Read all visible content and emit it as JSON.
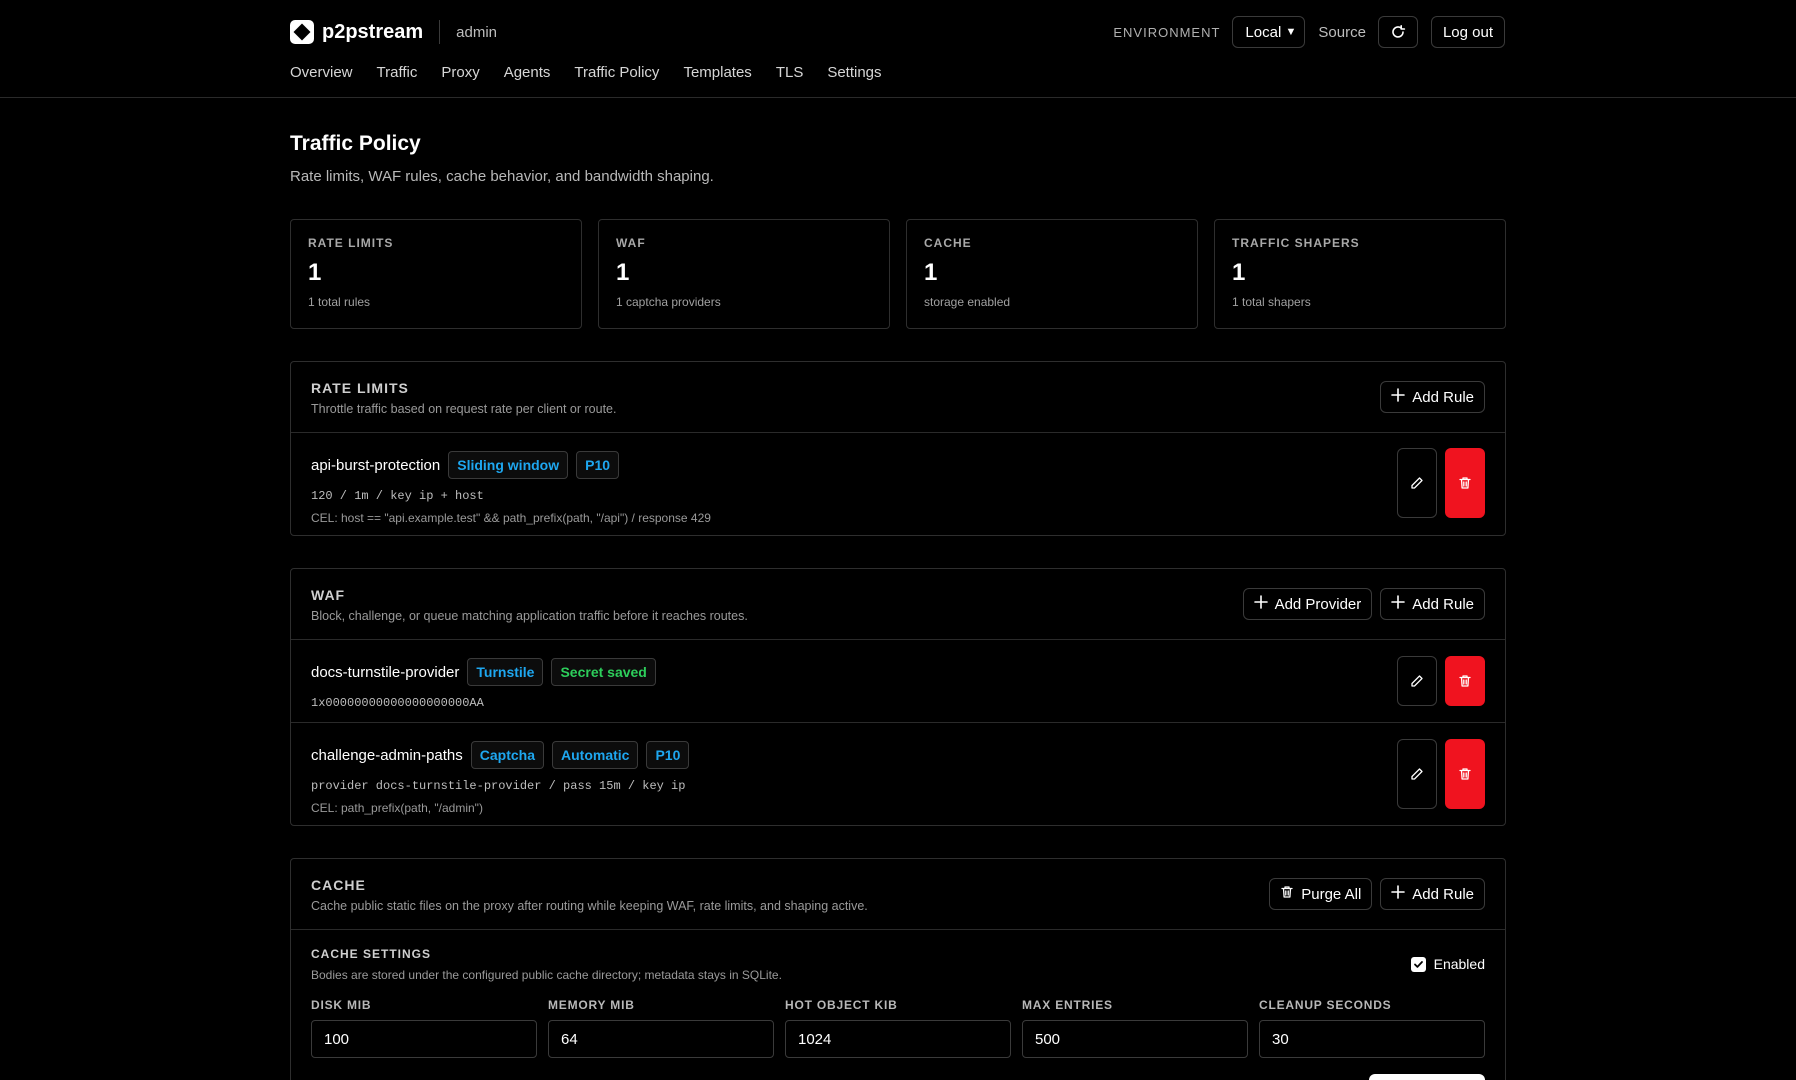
{
  "header": {
    "brand": "p2pstream",
    "user": "admin",
    "env_label": "ENVIRONMENT",
    "env_value": "Local",
    "source": "Source",
    "logout": "Log out"
  },
  "nav": [
    "Overview",
    "Traffic",
    "Proxy",
    "Agents",
    "Traffic Policy",
    "Templates",
    "TLS",
    "Settings"
  ],
  "page": {
    "title": "Traffic Policy",
    "subtitle": "Rate limits, WAF rules, cache behavior, and bandwidth shaping."
  },
  "stats": [
    {
      "label": "RATE LIMITS",
      "value": "1",
      "sub": "1 total rules"
    },
    {
      "label": "WAF",
      "value": "1",
      "sub": "1 captcha providers"
    },
    {
      "label": "CACHE",
      "value": "1",
      "sub": "storage enabled"
    },
    {
      "label": "TRAFFIC SHAPERS",
      "value": "1",
      "sub": "1 total shapers"
    }
  ],
  "rate_limits": {
    "title": "RATE LIMITS",
    "desc": "Throttle traffic based on request rate per client or route.",
    "add_rule": "Add Rule",
    "rules": [
      {
        "name": "api-burst-protection",
        "tags": [
          "Sliding window",
          "P10"
        ],
        "line": "120 / 1m / key ip + host",
        "cel": "CEL: host == \"api.example.test\" && path_prefix(path, \"/api\") / response 429"
      }
    ]
  },
  "waf": {
    "title": "WAF",
    "desc": "Block, challenge, or queue matching application traffic before it reaches routes.",
    "add_provider": "Add Provider",
    "add_rule": "Add Rule",
    "provider": {
      "name": "docs-turnstile-provider",
      "tag_type": "Turnstile",
      "tag_status": "Secret saved",
      "line": "1x00000000000000000000AA"
    },
    "rule": {
      "name": "challenge-admin-paths",
      "tags": [
        "Captcha",
        "Automatic",
        "P10"
      ],
      "line": "provider docs-turnstile-provider / pass 15m / key ip",
      "cel": "CEL: path_prefix(path, \"/admin\")"
    }
  },
  "cache": {
    "title": "CACHE",
    "desc": "Cache public static files on the proxy after routing while keeping WAF, rate limits, and shaping active.",
    "purge_all": "Purge All",
    "add_rule": "Add Rule",
    "settings": {
      "title": "CACHE SETTINGS",
      "desc": "Bodies are stored under the configured public cache directory; metadata stays in SQLite.",
      "enabled_label": "Enabled",
      "fields": [
        {
          "label": "DISK MIB",
          "value": "100"
        },
        {
          "label": "MEMORY MIB",
          "value": "64"
        },
        {
          "label": "HOT OBJECT KIB",
          "value": "1024"
        },
        {
          "label": "MAX ENTRIES",
          "value": "500"
        },
        {
          "label": "CLEANUP SECONDS",
          "value": "30"
        }
      ]
    }
  },
  "colors": {
    "accent_blue": "#1ea7f0",
    "success_green": "#2dce5b",
    "danger_red": "#f0131f"
  }
}
